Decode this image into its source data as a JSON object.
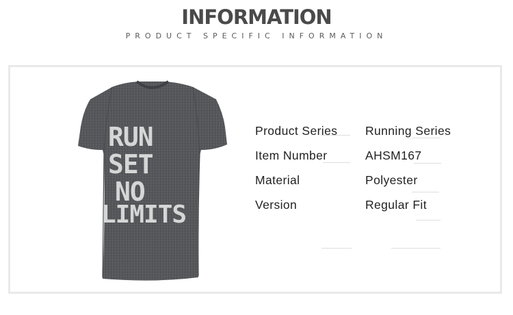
{
  "header": {
    "title": "INFORMATION",
    "subtitle": "PRODUCT SPECIFIC INFORMATION"
  },
  "product_image": {
    "print_text": [
      "RUN",
      "SET",
      "NO",
      "LIMITS"
    ],
    "shirt_color": "#55575b",
    "print_color": "#d6d6d6"
  },
  "specs": [
    {
      "label": "Product Series",
      "value": "Running Series"
    },
    {
      "label": "Item Number",
      "value": "AHSM167"
    },
    {
      "label": "Material",
      "value": "Polyester"
    },
    {
      "label": "Version",
      "value": "Regular Fit"
    }
  ]
}
